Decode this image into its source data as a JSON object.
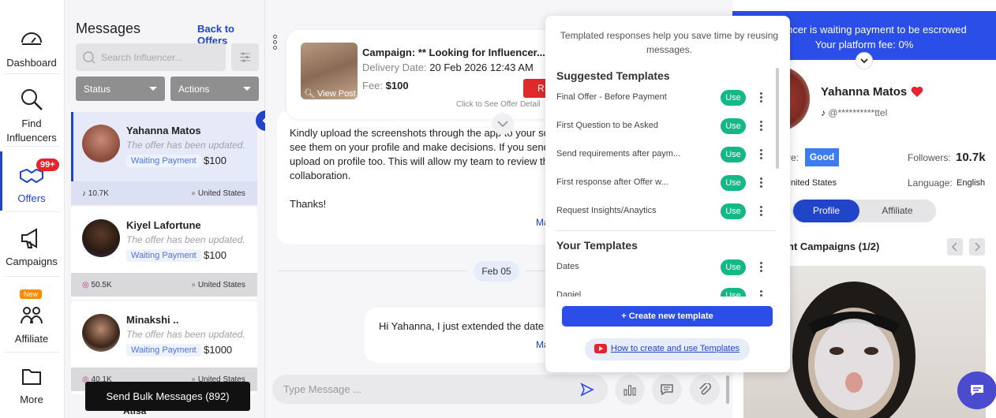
{
  "nav": {
    "items": [
      {
        "label": "Dashboard"
      },
      {
        "label": "Find Influencers"
      },
      {
        "label": "Offers",
        "badge": "99+"
      },
      {
        "label": "Campaigns"
      },
      {
        "label": "Affiliate",
        "badge": "New"
      },
      {
        "label": "More"
      }
    ]
  },
  "list": {
    "title": "Messages",
    "back_link": "Back to Offers",
    "search_placeholder": "Search Influencer...",
    "status_label": "Status",
    "actions_label": "Actions",
    "conversations": [
      {
        "name": "Yahanna Matos",
        "update": "The offer has been updated.",
        "status": "Waiting Payment",
        "amount": "$100",
        "followers": "10.7K",
        "platform": "tiktok",
        "location": "United States"
      },
      {
        "name": "Kiyel Lafortune",
        "update": "The offer has been updated.",
        "status": "Waiting Payment",
        "amount": "$100",
        "followers": "50.5K",
        "platform": "instagram",
        "location": "United States"
      },
      {
        "name": "Minakshi ..",
        "update": "The offer has been updated.",
        "status": "Waiting Payment",
        "amount": "$1000",
        "followers": "40.1K",
        "platform": "instagram",
        "location": "United States"
      },
      {
        "name": "Atisa"
      }
    ],
    "bulk_button": "Send Bulk Messages (892)"
  },
  "chat": {
    "offer": {
      "campaign": "Campaign: ** Looking for Influencer...",
      "delivery_label": "Delivery Date:",
      "delivery_value": "20 Feb 2026 12:43 AM",
      "fee_label": "Fee:",
      "fee_value": "$100",
      "view_post": "View Post",
      "red_button": "R",
      "hint": "Click to See Offer Detail"
    },
    "message1": {
      "lines": [
        "Kindly upload the screenshots through the app to your social",
        "see them on your profile and make decisions. If you sending o",
        "upload on profile too. This will allow my team to review them",
        "collaboration."
      ],
      "thanks": "Thanks!",
      "more": "Ma"
    },
    "date_separator": "Feb 05",
    "message2": {
      "text": "Hi Yahanna, I just extended the date of d",
      "more": "Ma"
    },
    "input_placeholder": "Type Message ..."
  },
  "popup": {
    "intro": "Templated responses help you save time by reusing messages.",
    "suggested_title": "Suggested Templates",
    "suggested": [
      {
        "name": "Final Offer - Before Payment",
        "action": "Use"
      },
      {
        "name": "First Question to be Asked",
        "action": "Use"
      },
      {
        "name": "Send requirements after paym...",
        "action": "Use"
      },
      {
        "name": "First response after Offer w...",
        "action": "Use"
      },
      {
        "name": "Request Insights/Anaytics",
        "action": "Use"
      }
    ],
    "yours_title": "Your Templates",
    "yours": [
      {
        "name": "Dates",
        "action": "Use"
      },
      {
        "name": "Daniel",
        "action": "Use"
      }
    ],
    "create_button": "+ Create new template",
    "how_link": "How to create and use Templates"
  },
  "profile": {
    "banner_line1": "Influencer is waiting payment to be escrowed",
    "banner_line2": "Your platform fee: 0%",
    "name": "Yahanna Matos",
    "handle": "@**********ttel",
    "score_label": "re:",
    "score_value": "Good",
    "followers_label": "Followers:",
    "followers_value": "10.7k",
    "country": "United States",
    "language_label": "Language:",
    "language_value": "English",
    "tab_profile": "Profile",
    "tab_affiliate": "Affiliate",
    "campaigns_title": "nt Campaigns (1/2)"
  },
  "colors": {
    "accent": "#2145c9",
    "banner": "#2b4ee9",
    "use_green": "#13b886",
    "badge_red": "#e8232f"
  }
}
